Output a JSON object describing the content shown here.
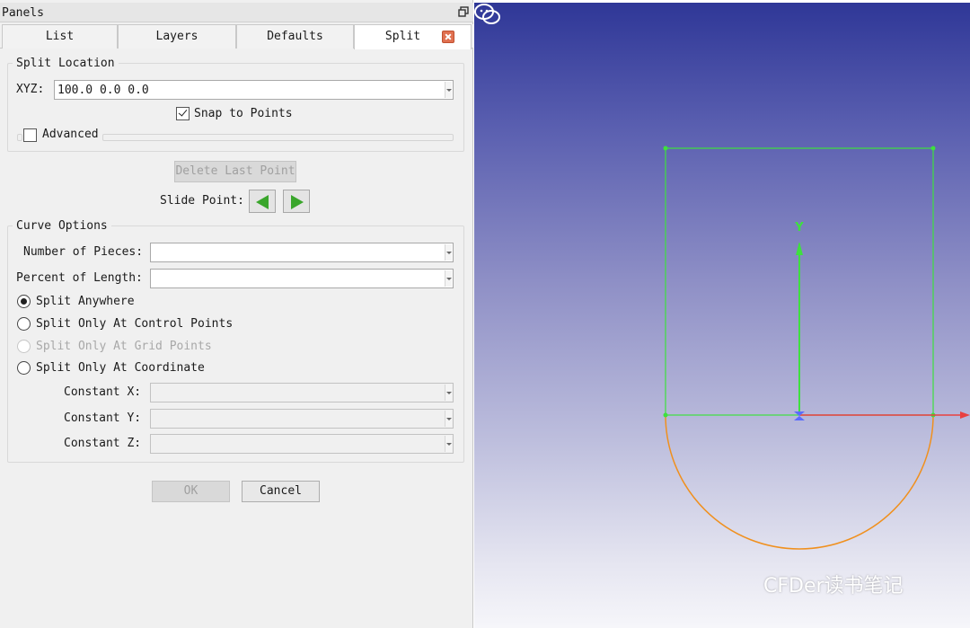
{
  "panel": {
    "title": "Panels",
    "tabs": [
      {
        "label": "List"
      },
      {
        "label": "Layers"
      },
      {
        "label": "Defaults"
      },
      {
        "label": "Split"
      }
    ]
  },
  "split_location": {
    "title": "Split Location",
    "xyz_label": "XYZ:",
    "xyz_value": "100.0 0.0 0.0",
    "snap_label": "Snap to Points",
    "snap_checked": true,
    "advanced_label": "Advanced",
    "advanced_checked": false
  },
  "actions": {
    "delete_last_point": "Delete Last Point",
    "slide_point_label": "Slide Point:"
  },
  "curve_options": {
    "title": "Curve Options",
    "pieces_label": "Number of Pieces:",
    "pieces_value": "",
    "percent_label": "Percent of Length:",
    "percent_value": "",
    "radios": [
      {
        "label": "Split Anywhere",
        "checked": true,
        "enabled": true
      },
      {
        "label": "Split Only At Control Points",
        "checked": false,
        "enabled": true
      },
      {
        "label": "Split Only At Grid Points",
        "checked": false,
        "enabled": false
      },
      {
        "label": "Split Only At Coordinate",
        "checked": false,
        "enabled": true
      }
    ],
    "const_x_label": "Constant X:",
    "const_y_label": "Constant Y:",
    "const_z_label": "Constant Z:"
  },
  "footer": {
    "ok": "OK",
    "cancel": "Cancel"
  },
  "viewport": {
    "axis_y_label": "Y",
    "watermark": "CFDer读书笔记",
    "colors": {
      "curve_green": "#3ee03e",
      "arc_orange": "#f0901e",
      "axis_red": "#e84040",
      "axis_blue": "#5a6cff"
    }
  }
}
